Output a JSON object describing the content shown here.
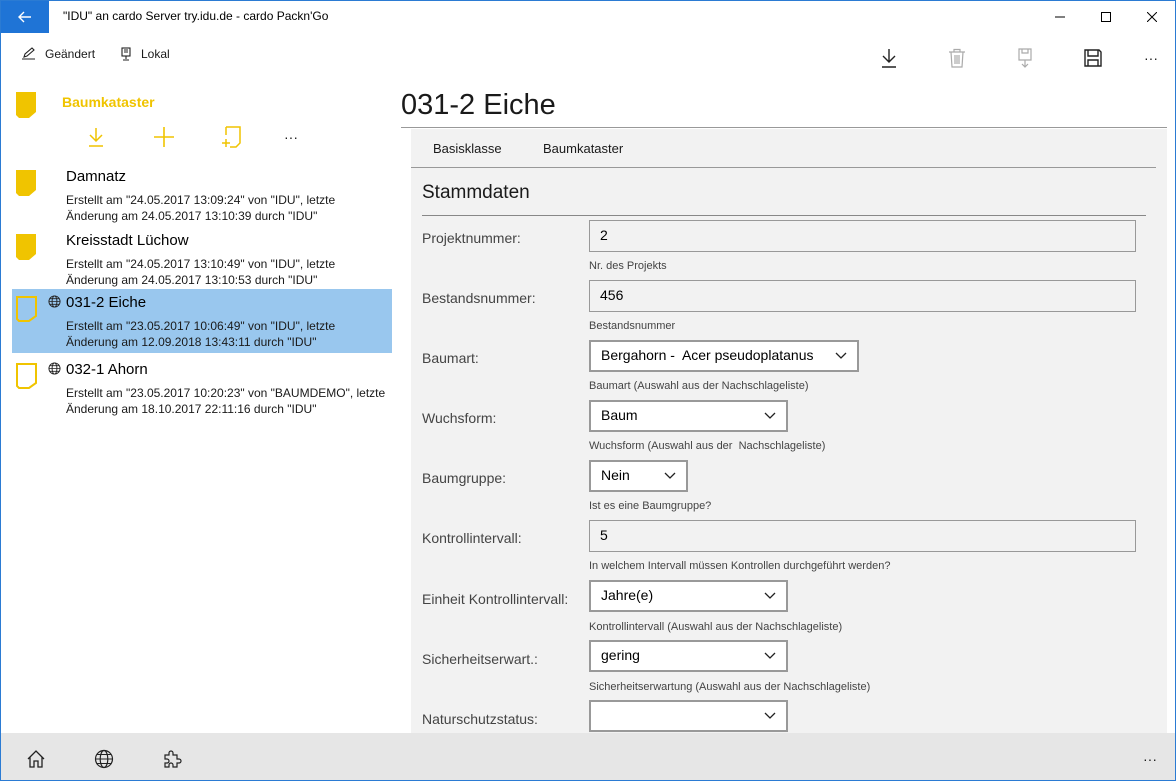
{
  "window": {
    "title": "\"IDU\" an cardo Server try.idu.de - cardo Packn'Go"
  },
  "toolbar": {
    "changed_label": "Geändert",
    "local_label": "Lokal",
    "more_label": "···"
  },
  "folder": {
    "title": "Baumkataster",
    "more_label": "···",
    "accent_color": "#f0c400"
  },
  "list": {
    "items": [
      {
        "title": "Damnatz",
        "desc": "Erstellt am \"24.05.2017 13:09:24\" von \"IDU\", letzte Änderung am 24.05.2017 13:10:39 durch \"IDU\"",
        "icon": "folder-doc-icon",
        "selected": false
      },
      {
        "title": "Kreisstadt Lüchow",
        "desc": "Erstellt am \"24.05.2017 13:10:49\" von \"IDU\", letzte Änderung am 24.05.2017 13:10:53 durch \"IDU\"",
        "icon": "folder-doc-icon",
        "selected": false
      },
      {
        "title": "031-2 Eiche",
        "desc": "Erstellt am \"23.05.2017 10:06:49\" von \"IDU\", letzte Änderung am 12.09.2018 13:43:11 durch \"IDU\"",
        "icon": "doc-outline-icon",
        "selected": true
      },
      {
        "title": "032-1 Ahorn",
        "desc": "Erstellt am \"23.05.2017 10:20:23\" von \"BAUMDEMO\", letzte Änderung am 18.10.2017 22:11:16 durch \"IDU\"",
        "icon": "doc-outline-icon",
        "selected": false
      }
    ],
    "selected_color": "#99c7ee"
  },
  "record": {
    "title": "031-2 Eiche",
    "tabs": [
      {
        "label": "Basisklasse"
      },
      {
        "label": "Baumkataster"
      }
    ],
    "section_title": "Stammdaten",
    "fields": {
      "projektnummer": {
        "label": "Projektnummer:",
        "value": "2",
        "hint": "Nr. des Projekts"
      },
      "bestandsnummer": {
        "label": "Bestandsnummer:",
        "value": "456",
        "hint": "Bestandsnummer"
      },
      "baumart": {
        "label": "Baumart:",
        "value": "Bergahorn -  Acer pseudoplatanus",
        "hint": "Baumart (Auswahl aus der Nachschlageliste)"
      },
      "wuchsform": {
        "label": "Wuchsform:",
        "value": "Baum",
        "hint": "Wuchsform (Auswahl aus der  Nachschlageliste)"
      },
      "baumgruppe": {
        "label": "Baumgruppe:",
        "value": "Nein",
        "hint": "Ist es eine Baumgruppe?"
      },
      "kontrollintervall": {
        "label": "Kontrollintervall:",
        "value": "5",
        "hint": "In welchem Intervall müssen Kontrollen durchgeführt werden?"
      },
      "einheit": {
        "label": "Einheit Kontrollintervall:",
        "value": "Jahre(e)",
        "hint": "Kontrollintervall (Auswahl aus der Nachschlageliste)"
      },
      "sicherheit": {
        "label": "Sicherheitserwart.:",
        "value": "gering",
        "hint": "Sicherheitserwartung (Auswahl aus der Nachschlageliste)"
      },
      "naturschutz": {
        "label": "Naturschutzstatus:",
        "value": ""
      }
    }
  },
  "bottombar": {
    "more_label": "···"
  }
}
